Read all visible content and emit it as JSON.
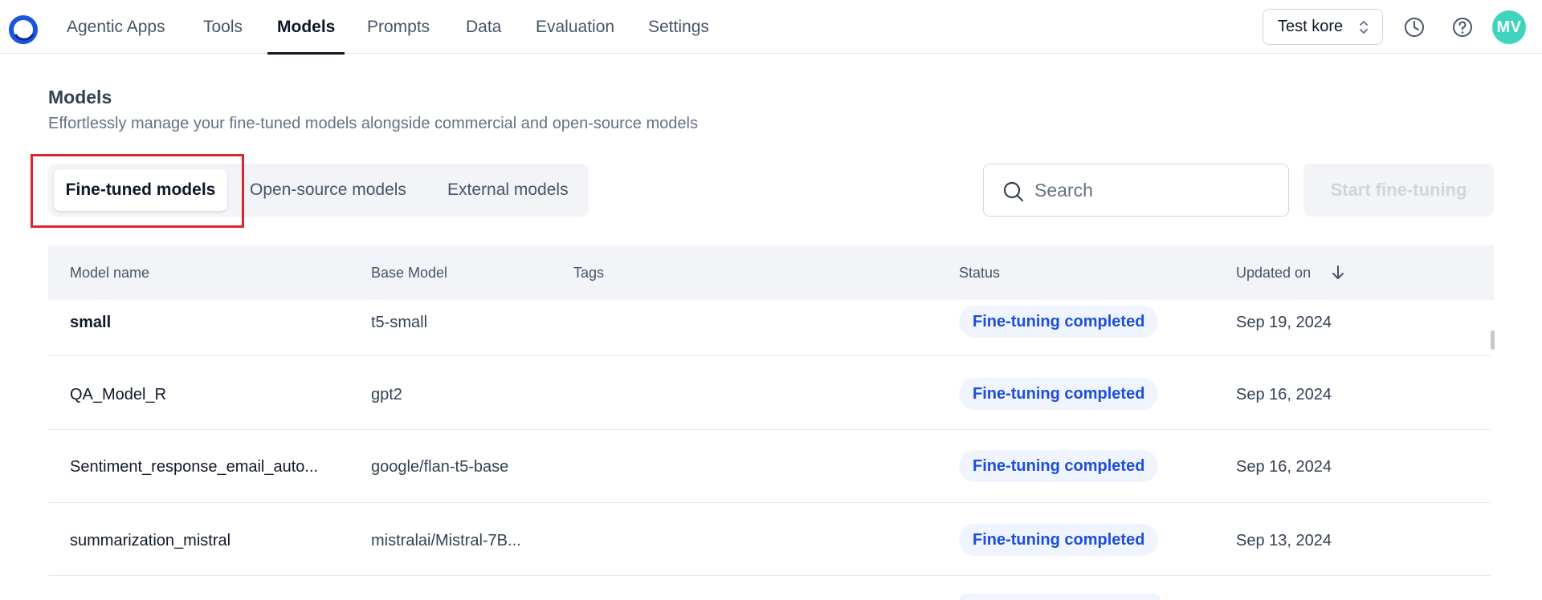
{
  "nav": {
    "items": [
      {
        "label": "Agentic Apps",
        "active": false
      },
      {
        "label": "Tools",
        "active": false
      },
      {
        "label": "Models",
        "active": true
      },
      {
        "label": "Prompts",
        "active": false
      },
      {
        "label": "Data",
        "active": false
      },
      {
        "label": "Evaluation",
        "active": false
      },
      {
        "label": "Settings",
        "active": false
      }
    ],
    "account": "Test kore",
    "avatar_initials": "MV",
    "icons": [
      "history-icon",
      "help-icon"
    ]
  },
  "header": {
    "title": "Models",
    "subtitle": "Effortlessly manage your fine-tuned models alongside commercial and open-source models"
  },
  "tabs": [
    {
      "label": "Fine-tuned models",
      "active": true
    },
    {
      "label": "Open-source models",
      "active": false
    },
    {
      "label": "External models",
      "active": false
    }
  ],
  "search": {
    "placeholder": "Search",
    "value": ""
  },
  "start_button": {
    "label": "Start fine-tuning",
    "disabled": true
  },
  "table": {
    "columns": [
      "Model name",
      "Base Model",
      "Tags",
      "Status",
      "Updated on"
    ],
    "sort_column": "Updated on",
    "sort_direction": "desc",
    "rows": [
      {
        "name": "small",
        "base_model": "t5-small",
        "tags": "",
        "status": "Fine-tuning completed",
        "updated": "Sep 19, 2024"
      },
      {
        "name": "QA_Model_R",
        "base_model": "gpt2",
        "tags": "",
        "status": "Fine-tuning completed",
        "updated": "Sep 16, 2024"
      },
      {
        "name": "Sentiment_response_email_auto...",
        "base_model": "google/flan-t5-base",
        "tags": "",
        "status": "Fine-tuning completed",
        "updated": "Sep 16, 2024"
      },
      {
        "name": "summarization_mistral",
        "base_model": "mistralai/Mistral-7B...",
        "tags": "",
        "status": "Fine-tuning completed",
        "updated": "Sep 13, 2024"
      }
    ]
  },
  "colors": {
    "accent": "#1d4ed8",
    "badge_bg": "#eff4ff",
    "highlight": "#e0242b",
    "avatar": "#3ed4bd"
  }
}
